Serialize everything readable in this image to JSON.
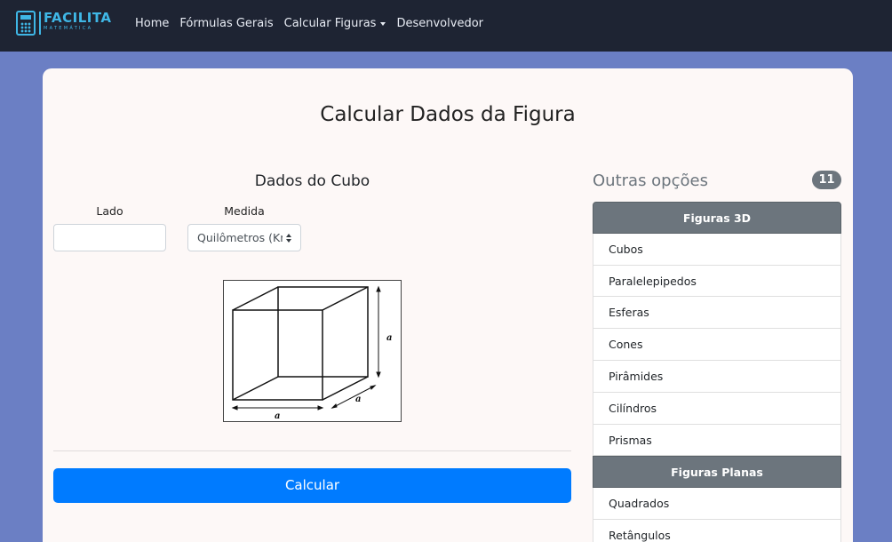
{
  "brand": {
    "name": "FACILITA",
    "subtitle": "MATEMÁTICA"
  },
  "nav": {
    "home": "Home",
    "formulas": "Fórmulas Gerais",
    "calcular": "Calcular Figuras",
    "dev": "Desenvolvedor"
  },
  "page": {
    "title": "Calcular Dados da Figura"
  },
  "form": {
    "title": "Dados do Cubo",
    "lado_label": "Lado",
    "lado_value": "",
    "medida_label": "Medida",
    "medida_value": "Quilômetros (Km)",
    "submit": "Calcular"
  },
  "figure": {
    "edge_label": "a"
  },
  "sidebar": {
    "title": "Outras opções",
    "count": "11",
    "sections": [
      {
        "header": "Figuras 3D",
        "items": [
          "Cubos",
          "Paralelepipedos",
          "Esferas",
          "Cones",
          "Pirâmides",
          "Cilíndros",
          "Prismas"
        ]
      },
      {
        "header": "Figuras Planas",
        "items": [
          "Quadrados",
          "Retângulos"
        ]
      }
    ]
  },
  "colors": {
    "navbar": "#1e2433",
    "brand": "#3fb7e6",
    "background": "#6b7fc4",
    "primary": "#007bff",
    "secondary": "#6c757d"
  }
}
